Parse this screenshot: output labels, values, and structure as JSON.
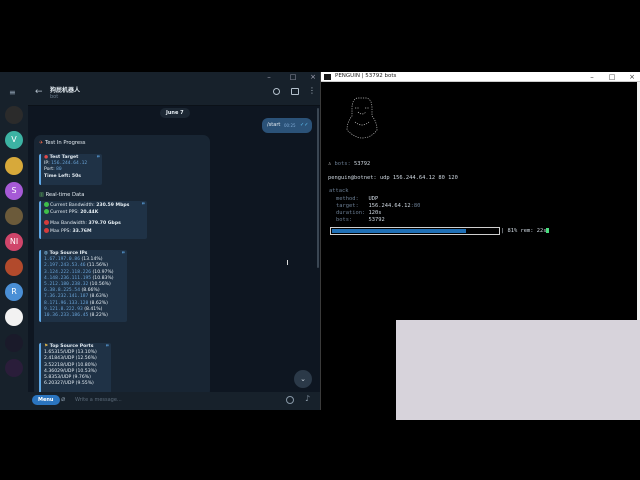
{
  "telegram": {
    "chat_name": "狗屁机器人",
    "chat_status": "bot",
    "date_pill": "June 7",
    "outgoing": {
      "text": "/start",
      "time": "00:25"
    },
    "message": {
      "title": "Test In Progress",
      "target_header": "Test Target",
      "target": {
        "ip_label": "IP:",
        "ip": "156.244.64.12",
        "port_label": "Port:",
        "port": "80",
        "timeleft": "Time Left: 50s"
      },
      "realtime_header": "Real-time Data",
      "realtime": {
        "bw_label": "Current Bandwidth:",
        "bw": "230.59 Mbps",
        "pps_label": "Current PPS:",
        "pps": "20.44K",
        "maxbw_label": "Max Bandwidth:",
        "maxbw": "379.70 Gbps",
        "maxpps_label": "Max PPS:",
        "maxpps": "33.76M"
      },
      "ips_header": "Top Source IPs",
      "ips": [
        {
          "ip": "1.67.197.0.86",
          "pct": "(13.14%)"
        },
        {
          "ip": "2.197.243.53.46",
          "pct": "(11.56%)"
        },
        {
          "ip": "3.124.222.118.226",
          "pct": "(10.97%)"
        },
        {
          "ip": "4.148.236.111.195",
          "pct": "(10.83%)"
        },
        {
          "ip": "5.212.180.238.32",
          "pct": "(10.56%)"
        },
        {
          "ip": "6.38.8.225.54",
          "pct": "(8.66%)"
        },
        {
          "ip": "7.36.232.141.187",
          "pct": "(8.63%)"
        },
        {
          "ip": "8.171.96.133.128",
          "pct": "(8.62%)"
        },
        {
          "ip": "9.121.8.222.93",
          "pct": "(8.41%)"
        },
        {
          "ip": "10.36.233.186.45",
          "pct": "(8.22%)"
        }
      ],
      "ports_header": "Top Source Ports",
      "ports": [
        "1.65315/UDP (13.10%)",
        "2.41843/UDP (12.56%)",
        "3.52218/UDP (10.80%)",
        "4.36029/UDP (10.53%)",
        "5.8353/UDP (9.76%)",
        "6.20327/UDP (9.55%)"
      ]
    },
    "input": {
      "menu_label": "Menu",
      "placeholder": "Write a message..."
    },
    "rail": [
      {
        "label": "",
        "color": "#2b2b2b"
      },
      {
        "label": "V",
        "color": "#3cb3a3"
      },
      {
        "label": "",
        "color": "#d7a93a"
      },
      {
        "label": "S",
        "color": "#a65ad6"
      },
      {
        "label": "",
        "color": "#6b5a3a"
      },
      {
        "label": "NI",
        "color": "#d0456a"
      },
      {
        "label": "",
        "color": "#b24a2c"
      },
      {
        "label": "R",
        "color": "#4a8fd6"
      },
      {
        "label": "",
        "color": "#f2f2f2"
      },
      {
        "label": "",
        "color": "#1a1a2a"
      },
      {
        "label": "",
        "color": "#2a1d3a"
      }
    ]
  },
  "terminal": {
    "window_title": "PENGUIN | 53792 bots",
    "bots_label": "bots:",
    "bots_count": "53792",
    "prompt_user": "penguin@botnet:",
    "command": "udp 156.244.64.12 80 120",
    "attack_label": "attack",
    "method_label": "method:",
    "method": "UDP",
    "target_label": "target:",
    "target_ip": "156.244.64.12",
    "target_port": ":80",
    "duration_label": "duration:",
    "duration": "120s",
    "bots2_label": "bots:",
    "bots2": "53792",
    "progress_fraction": 0.81,
    "progress_text": "| 81% rem: 22s"
  }
}
